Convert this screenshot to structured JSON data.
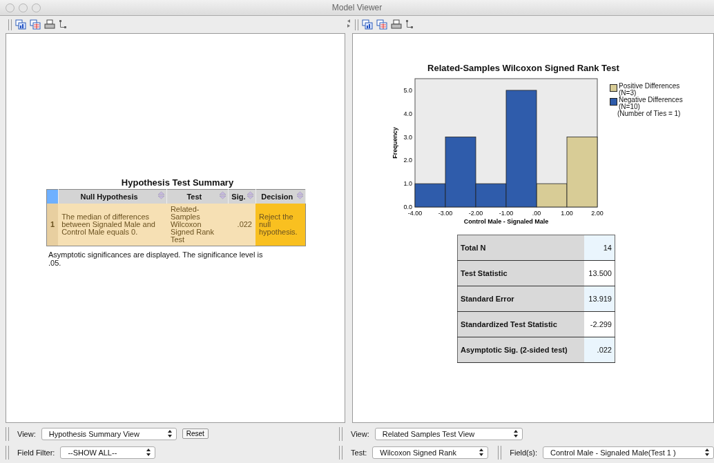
{
  "window": {
    "title": "Model Viewer"
  },
  "left_pane": {
    "summary": {
      "title": "Hypothesis Test Summary",
      "columns": [
        "Null Hypothesis",
        "Test",
        "Sig.",
        "Decision"
      ],
      "rows": [
        {
          "index": "1",
          "null_hypothesis": "The median of differences between Signaled Male and Control Male equals 0.",
          "test": "Related-Samples Wilcoxon Signed Rank Test",
          "sig": ".022",
          "decision": "Reject the null hypothesis."
        }
      ],
      "footnote": "Asymptotic significances are displayed.  The significance level is .05."
    },
    "view": {
      "label": "View:",
      "value": "Hypothesis Summary View"
    },
    "reset_button": "Reset",
    "field_filter": {
      "label": "Field Filter:",
      "value": "--SHOW ALL--"
    }
  },
  "right_pane": {
    "chart_data": {
      "type": "bar",
      "title": "Related-Samples Wilcoxon Signed Rank Test",
      "xlabel": "Control Male - Signaled Male",
      "ylabel": "Frequency",
      "x": [
        -4,
        -3,
        -2,
        -1,
        0,
        1
      ],
      "xlim": [
        -4,
        2
      ],
      "ylim": [
        0,
        5.5
      ],
      "xticks": [
        {
          "value": -4,
          "label": "-4.00"
        },
        {
          "value": -3,
          "label": "-3.00"
        },
        {
          "value": -2,
          "label": "-2.00"
        },
        {
          "value": -1,
          "label": "-1.00"
        },
        {
          "value": 0,
          "label": ".00"
        },
        {
          "value": 1,
          "label": "1.00"
        },
        {
          "value": 2,
          "label": "2.00"
        }
      ],
      "yticks": [
        {
          "value": 0,
          "label": "0.0"
        },
        {
          "value": 1,
          "label": "1.0"
        },
        {
          "value": 2,
          "label": "2.0"
        },
        {
          "value": 3,
          "label": "3.0"
        },
        {
          "value": 4,
          "label": "4.0"
        },
        {
          "value": 5,
          "label": "5.0"
        }
      ],
      "series": [
        {
          "name": "Positive Differences (N=3)",
          "color": "#d8cc96",
          "values": [
            null,
            null,
            null,
            null,
            1,
            3
          ]
        },
        {
          "name": "Negative Differences (N=10)",
          "color": "#2f5cab",
          "values": [
            1,
            3,
            1,
            5,
            null,
            null
          ]
        }
      ],
      "legend": "right",
      "annotations": [
        "(Number of Ties = 1)"
      ]
    },
    "stats": [
      {
        "label": "Total N",
        "value": "14"
      },
      {
        "label": "Test Statistic",
        "value": "13.500"
      },
      {
        "label": "Standard Error",
        "value": "13.919"
      },
      {
        "label": "Standardized Test Statistic",
        "value": "-2.299"
      },
      {
        "label": "Asymptotic Sig. (2-sided test)",
        "value": ".022"
      }
    ],
    "view": {
      "label": "View:",
      "value": "Related Samples Test View"
    },
    "test": {
      "label": "Test:",
      "value": "Wilcoxon Signed Rank"
    },
    "fields": {
      "label": "Field(s):",
      "value": "Control Male - Signaled Male(Test 1 )"
    }
  }
}
